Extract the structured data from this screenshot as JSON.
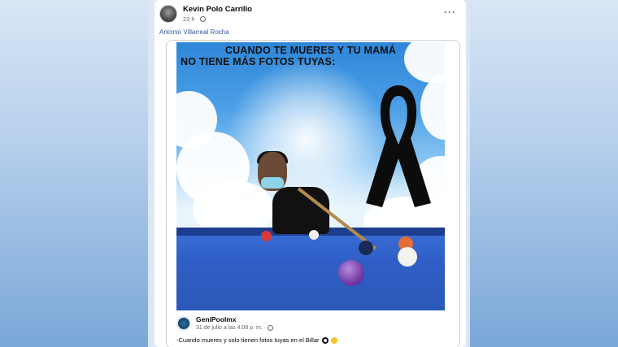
{
  "post": {
    "author": "Kevin Polo Carrillo",
    "time": "23 h",
    "separator": "·",
    "mention": "Antonio Villarreal Rocha",
    "more": "···"
  },
  "meme": {
    "caption_line1": "CUANDO TE MUERES Y TU MAMÁ",
    "caption_line2": "NO TIENE MÁS FOTOS TUYAS:"
  },
  "source": {
    "name": "GeniPoolmx",
    "date": "31 de julio a las 4:08 p. m.",
    "separator": "·",
    "text": "-Cuando mueres y solo tienen fotos tuyas en el Billar"
  },
  "icons": [
    "avatar",
    "globe-icon",
    "more-icon",
    "eight-ball-icon",
    "laugh-icon",
    "black-ribbon"
  ],
  "colors": {
    "link": "#385898",
    "table": "#2f5fc6"
  }
}
